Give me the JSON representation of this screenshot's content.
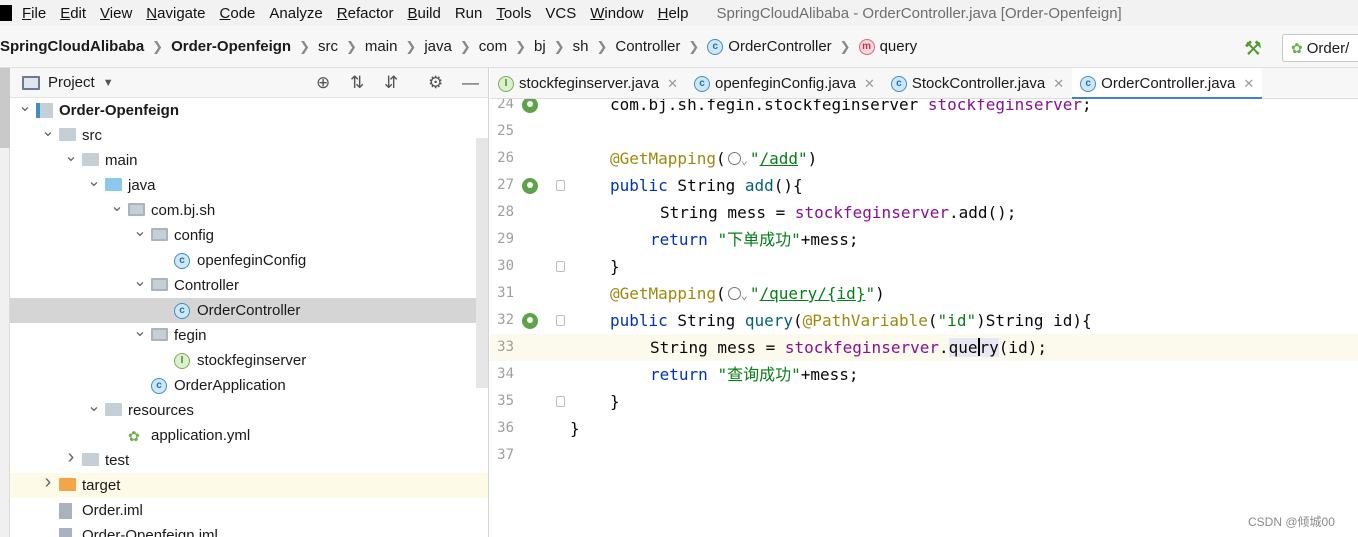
{
  "menu": {
    "items": [
      {
        "label": "File",
        "mnemonic": "F",
        "rest": "ile"
      },
      {
        "label": "Edit",
        "mnemonic": "E",
        "rest": "dit"
      },
      {
        "label": "View",
        "mnemonic": "V",
        "rest": "iew"
      },
      {
        "label": "Navigate",
        "mnemonic": "N",
        "rest": "avigate"
      },
      {
        "label": "Code",
        "mnemonic": "C",
        "rest": "ode"
      },
      {
        "label": "Analyze",
        "mnemonic": "",
        "rest": "Analyze"
      },
      {
        "label": "Refactor",
        "mnemonic": "R",
        "rest": "efactor"
      },
      {
        "label": "Build",
        "mnemonic": "B",
        "rest": "uild"
      },
      {
        "label": "Run",
        "mnemonic": "",
        "rest": "Run"
      },
      {
        "label": "Tools",
        "mnemonic": "T",
        "rest": "ools"
      },
      {
        "label": "VCS",
        "mnemonic": "",
        "rest": "VCS"
      },
      {
        "label": "Window",
        "mnemonic": "W",
        "rest": "indow"
      },
      {
        "label": "Help",
        "mnemonic": "H",
        "rest": "elp"
      }
    ],
    "window_title": "SpringCloudAlibaba - OrderController.java [Order-Openfeign]"
  },
  "breadcrumb": {
    "items": [
      "SpringCloudAlibaba",
      "Order-Openfeign",
      "src",
      "main",
      "java",
      "com",
      "bj",
      "sh",
      "Controller",
      "OrderController",
      "query"
    ],
    "run_config": "Order/"
  },
  "project_panel": {
    "title": "Project",
    "tree": [
      {
        "label": "Order-Openfeign",
        "depth": 1,
        "arrow": "down",
        "icon": "module",
        "bold": true
      },
      {
        "label": "src",
        "depth": 2,
        "arrow": "down",
        "icon": "folder"
      },
      {
        "label": "main",
        "depth": 3,
        "arrow": "down",
        "icon": "folder"
      },
      {
        "label": "java",
        "depth": 4,
        "arrow": "down",
        "icon": "folder-src"
      },
      {
        "label": "com.bj.sh",
        "depth": 5,
        "arrow": "down",
        "icon": "package"
      },
      {
        "label": "config",
        "depth": 6,
        "arrow": "down",
        "icon": "package"
      },
      {
        "label": "openfeginConfig",
        "depth": 7,
        "arrow": "",
        "icon": "class"
      },
      {
        "label": "Controller",
        "depth": 6,
        "arrow": "down",
        "icon": "package"
      },
      {
        "label": "OrderController",
        "depth": 7,
        "arrow": "",
        "icon": "class",
        "selected": true
      },
      {
        "label": "fegin",
        "depth": 6,
        "arrow": "down",
        "icon": "package"
      },
      {
        "label": "stockfeginserver",
        "depth": 7,
        "arrow": "",
        "icon": "interface"
      },
      {
        "label": "OrderApplication",
        "depth": 6,
        "arrow": "",
        "icon": "class-app"
      },
      {
        "label": "resources",
        "depth": 4,
        "arrow": "down",
        "icon": "resources"
      },
      {
        "label": "application.yml",
        "depth": 5,
        "arrow": "",
        "icon": "spring-yml"
      },
      {
        "label": "test",
        "depth": 3,
        "arrow": "right",
        "icon": "folder"
      },
      {
        "label": "target",
        "depth": 2,
        "arrow": "right",
        "icon": "folder-target",
        "excluded": true
      },
      {
        "label": "Order.iml",
        "depth": 2,
        "arrow": "",
        "icon": "file"
      },
      {
        "label": "Order-Openfeign.iml",
        "depth": 2,
        "arrow": "",
        "icon": "file"
      }
    ]
  },
  "editor": {
    "tabs": [
      {
        "label": "stockfeginserver.java",
        "icon": "interface",
        "active": false
      },
      {
        "label": "openfeginConfig.java",
        "icon": "class",
        "active": false
      },
      {
        "label": "StockController.java",
        "icon": "class",
        "active": false
      },
      {
        "label": "OrderController.java",
        "icon": "class",
        "active": true
      }
    ],
    "lines": [
      {
        "num": "24",
        "gutter": "bean",
        "fold": false,
        "current": false
      },
      {
        "num": "25",
        "gutter": "",
        "fold": false,
        "current": false
      },
      {
        "num": "26",
        "gutter": "",
        "fold": false,
        "current": false
      },
      {
        "num": "27",
        "gutter": "bean",
        "fold": true,
        "current": false
      },
      {
        "num": "28",
        "gutter": "",
        "fold": false,
        "current": false
      },
      {
        "num": "29",
        "gutter": "",
        "fold": false,
        "current": false
      },
      {
        "num": "30",
        "gutter": "",
        "fold": true,
        "current": false
      },
      {
        "num": "31",
        "gutter": "",
        "fold": false,
        "current": false
      },
      {
        "num": "32",
        "gutter": "bean",
        "fold": true,
        "current": false
      },
      {
        "num": "33",
        "gutter": "",
        "fold": false,
        "current": true
      },
      {
        "num": "34",
        "gutter": "",
        "fold": false,
        "current": false
      },
      {
        "num": "35",
        "gutter": "",
        "fold": true,
        "current": false
      },
      {
        "num": "36",
        "gutter": "",
        "fold": false,
        "current": false
      },
      {
        "num": "37",
        "gutter": "",
        "fold": false,
        "current": false
      }
    ],
    "code": {
      "l24": {
        "type": "com.bj.sh.fegin.stockfeginserver",
        "field": "stockfeginserver",
        "end": ";"
      },
      "l26": {
        "annotation": "@GetMapping",
        "path": "/add"
      },
      "l27": {
        "kw": "public",
        "rest1": " String ",
        "method": "add",
        "rest2": "(){"
      },
      "l28": {
        "pre": "String mess = ",
        "field": "stockfeginserver",
        "post": ".add();"
      },
      "l29": {
        "kw": "return",
        "str": "\"下单成功\"",
        "post": "+mess;"
      },
      "l30": {
        "text": "}"
      },
      "l31": {
        "annotation": "@GetMapping",
        "path": "/query/{id}"
      },
      "l32": {
        "kw": "public",
        "rest1": " String ",
        "method": "query",
        "p1": "(",
        "ann": "@PathVariable",
        "p2": "(",
        "str": "\"id\"",
        "p3": ")String id){"
      },
      "l33": {
        "pre": "String mess = ",
        "field": "stockfeginserver",
        "dot": ".",
        "call_a": "que",
        "call_b": "ry",
        "post": "(id);"
      },
      "l34": {
        "kw": "return",
        "str": "\"查询成功\"",
        "post": "+mess;"
      },
      "l35": {
        "text": "}"
      },
      "l36": {
        "text": "}"
      }
    }
  },
  "watermark": "CSDN @倾城00",
  "colors": {
    "accent": "#4083c9",
    "keyword": "#0033b3",
    "annotation": "#9e880d",
    "string": "#067d17",
    "field": "#871094",
    "method": "#00627a"
  }
}
